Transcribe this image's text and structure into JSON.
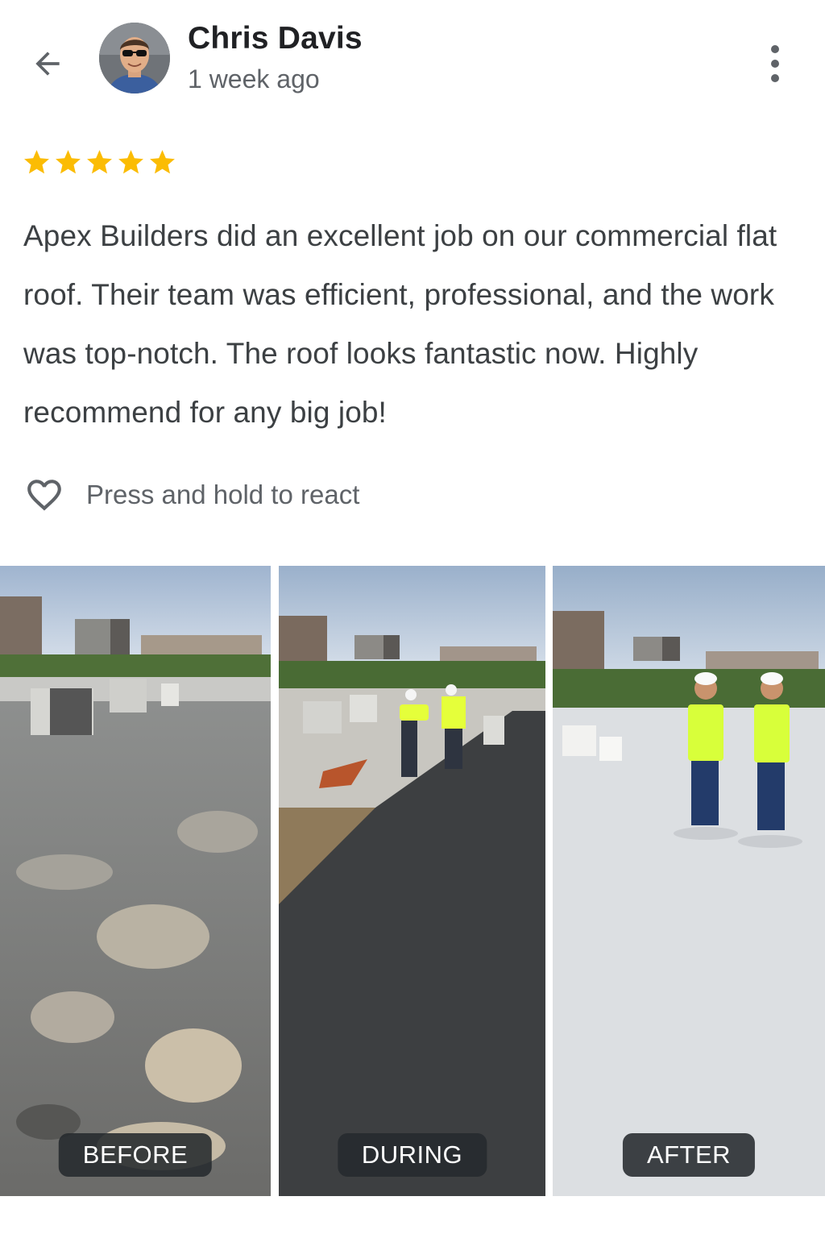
{
  "review": {
    "author_name": "Chris Davis",
    "time_ago": "1 week ago",
    "rating": 5,
    "text": "Apex Builders did an excellent job on our commercial flat roof. Their team was efficient, professional, and the work was top-notch. The roof looks fantastic now. Highly recommend for any big job!"
  },
  "react": {
    "label": "Press and hold to react"
  },
  "photos": [
    {
      "label": "BEFORE"
    },
    {
      "label": "DURING"
    },
    {
      "label": "AFTER"
    }
  ],
  "colors": {
    "star": "#fbbc04",
    "text_primary": "#202124",
    "text_secondary": "#5f6368",
    "label_bg": "#262a2e"
  }
}
